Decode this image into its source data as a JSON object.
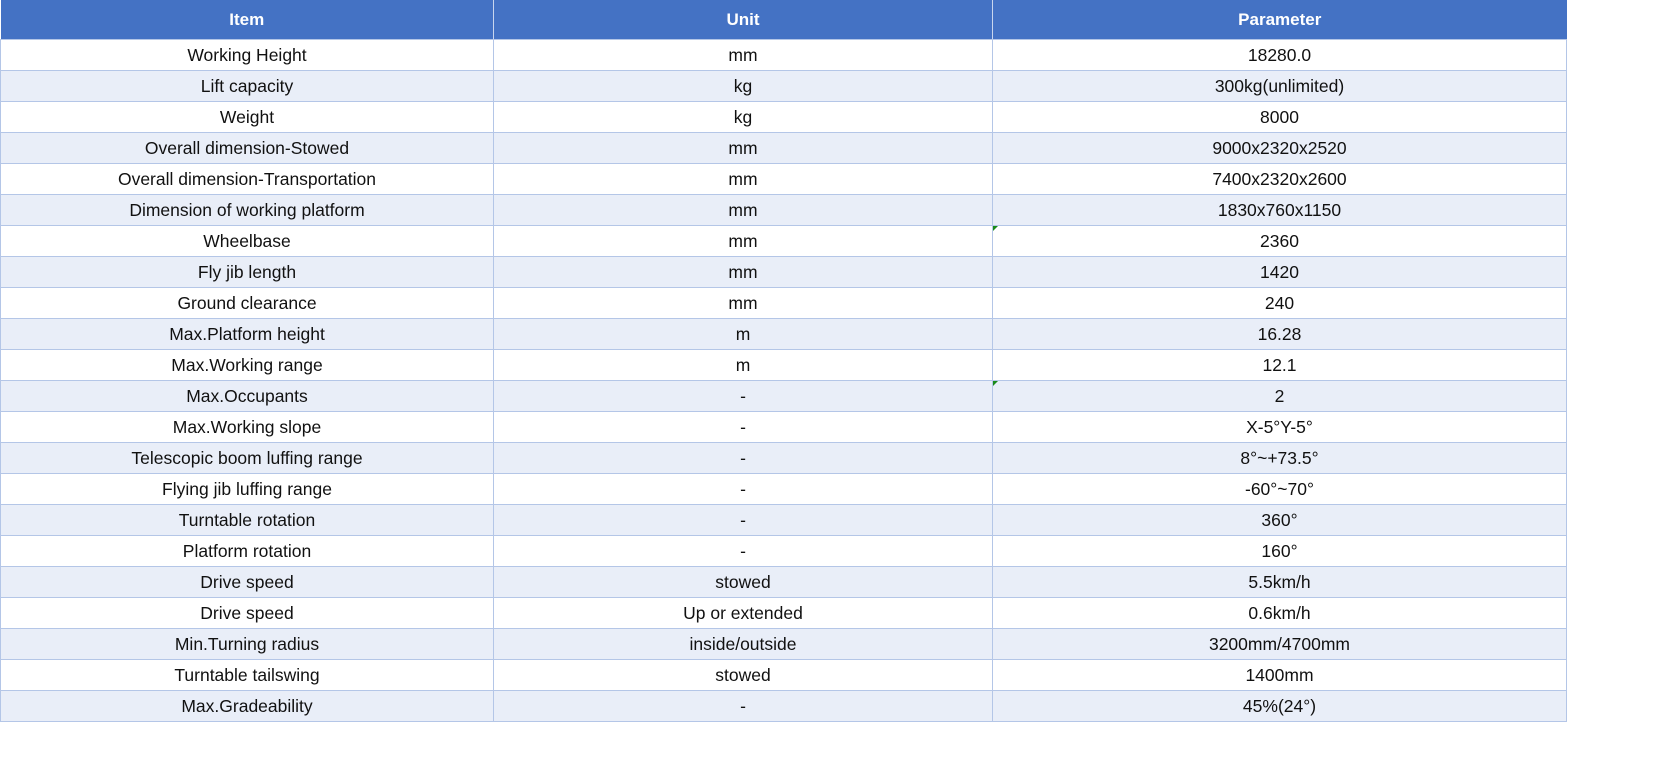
{
  "header": {
    "item": "Item",
    "unit": "Unit",
    "parameter": "Parameter"
  },
  "rows": [
    {
      "item": "Working Height",
      "unit": "mm",
      "parameter": "18280.0"
    },
    {
      "item": "Lift capacity",
      "unit": "kg",
      "parameter": "300kg(unlimited)"
    },
    {
      "item": "Weight",
      "unit": "kg",
      "parameter": "8000"
    },
    {
      "item": "Overall dimension-Stowed",
      "unit": "mm",
      "parameter": "9000x2320x2520"
    },
    {
      "item": "Overall dimension-Transportation",
      "unit": "mm",
      "parameter": "7400x2320x2600"
    },
    {
      "item": "Dimension of working platform",
      "unit": "mm",
      "parameter": "1830x760x1150"
    },
    {
      "item": "Wheelbase",
      "unit": "mm",
      "parameter": "2360"
    },
    {
      "item": "Fly jib length",
      "unit": "mm",
      "parameter": "1420"
    },
    {
      "item": "Ground clearance",
      "unit": "mm",
      "parameter": "240"
    },
    {
      "item": "Max.Platform height",
      "unit": "m",
      "parameter": "16.28"
    },
    {
      "item": "Max.Working range",
      "unit": "m",
      "parameter": "12.1"
    },
    {
      "item": "Max.Occupants",
      "unit": "-",
      "parameter": "2"
    },
    {
      "item": "Max.Working slope",
      "unit": "-",
      "parameter": "X-5°Y-5°"
    },
    {
      "item": "Telescopic boom luffing range",
      "unit": "-",
      "parameter": "8°~+73.5°"
    },
    {
      "item": "Flying jib luffing range",
      "unit": "-",
      "parameter": "-60°~70°"
    },
    {
      "item": "Turntable rotation",
      "unit": "-",
      "parameter": "360°"
    },
    {
      "item": "Platform rotation",
      "unit": "-",
      "parameter": "160°"
    },
    {
      "item": "Drive speed",
      "unit": "stowed",
      "parameter": "5.5km/h"
    },
    {
      "item": "Drive speed",
      "unit": "Up or extended",
      "parameter": "0.6km/h"
    },
    {
      "item": "Min.Turning radius",
      "unit": "inside/outside",
      "parameter": "3200mm/4700mm"
    },
    {
      "item": "Turntable tailswing",
      "unit": "stowed",
      "parameter": "1400mm"
    },
    {
      "item": "Max.Gradeability",
      "unit": "-",
      "parameter": "45%(24°)"
    }
  ],
  "colors": {
    "header_bg": "#4472c4",
    "header_text": "#ffffff",
    "band_bg": "#e9eef8",
    "grid_line": "#b4c6e7",
    "cell_marker": "#1a8a1a"
  }
}
